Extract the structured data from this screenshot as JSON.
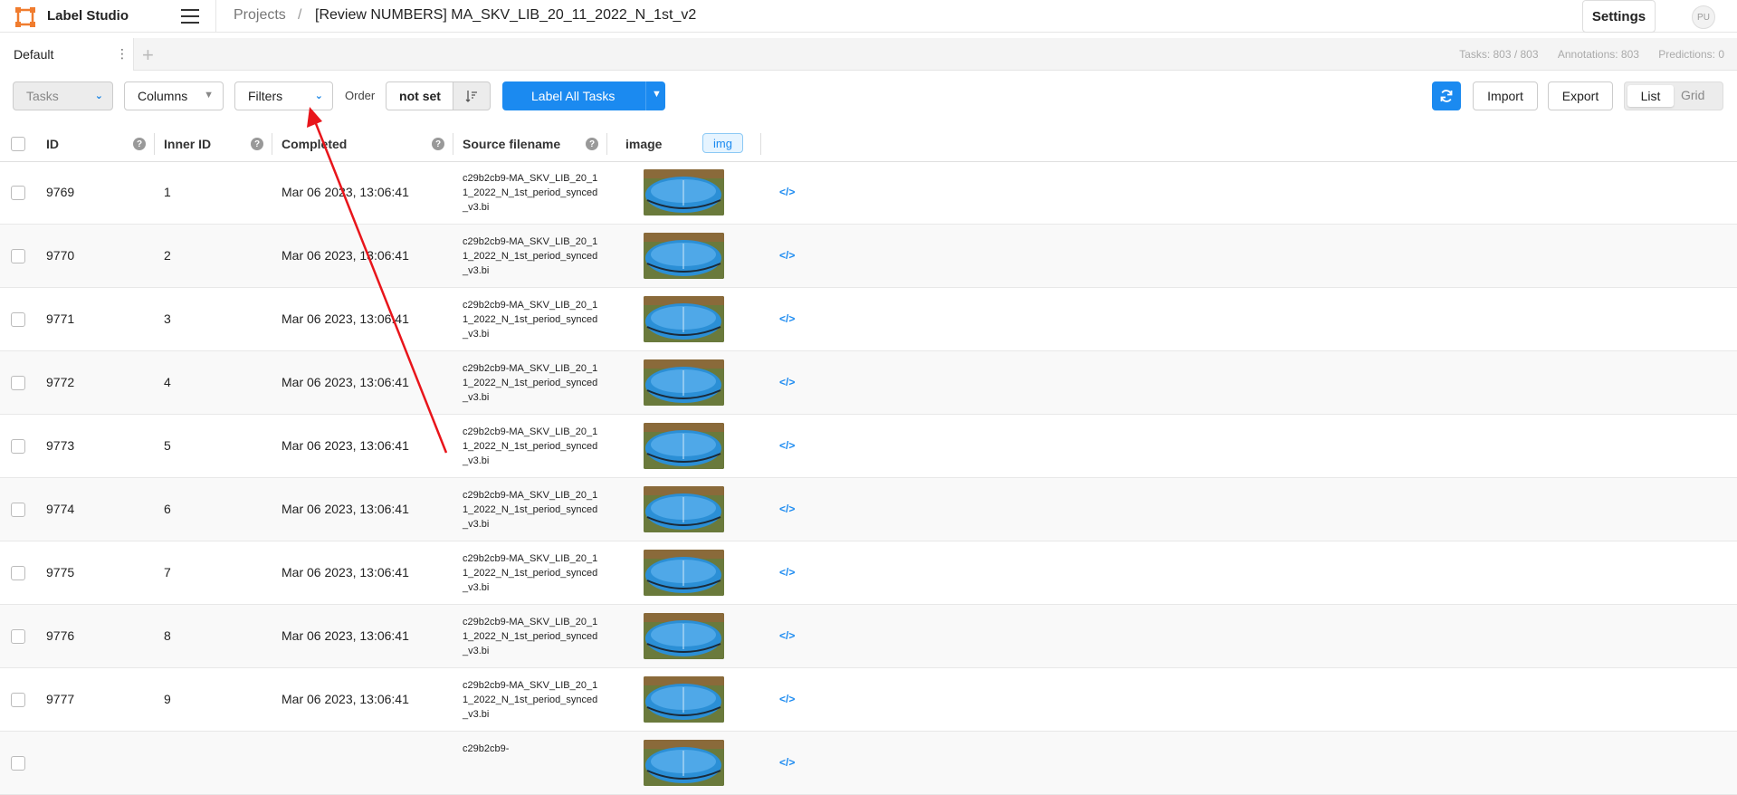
{
  "app": {
    "name": "Label Studio",
    "user_initials": "PU"
  },
  "breadcrumb": {
    "projects": "Projects",
    "separator": "/",
    "title": "[Review NUMBERS] MA_SKV_LIB_20_11_2022_N_1st_v2"
  },
  "header": {
    "settings_label": "Settings"
  },
  "tabs": {
    "items": [
      {
        "label": "Default"
      }
    ],
    "add": "+",
    "menu": "⋮"
  },
  "stats": {
    "tasks": "Tasks: 803 / 803",
    "annotations": "Annotations: 803",
    "predictions": "Predictions: 0"
  },
  "toolbar": {
    "tasks_label": "Tasks",
    "columns_label": "Columns",
    "filters_label": "Filters",
    "order_label": "Order",
    "order_value": "not set",
    "label_all_label": "Label All Tasks",
    "import_label": "Import",
    "export_label": "Export",
    "view_list": "List",
    "view_grid": "Grid"
  },
  "table": {
    "columns": [
      "ID",
      "Inner ID",
      "Completed",
      "Source filename",
      "image",
      "img"
    ],
    "help_glyph": "?",
    "rows": [
      {
        "id": "9769",
        "inner_id": "1",
        "completed": "Mar 06 2023, 13:06:41",
        "source": "c29b2cb9-MA_SKV_LIB_20_11_2022_N_1st_period_synced_v3.bi"
      },
      {
        "id": "9770",
        "inner_id": "2",
        "completed": "Mar 06 2023, 13:06:41",
        "source": "c29b2cb9-MA_SKV_LIB_20_11_2022_N_1st_period_synced_v3.bi"
      },
      {
        "id": "9771",
        "inner_id": "3",
        "completed": "Mar 06 2023, 13:06:41",
        "source": "c29b2cb9-MA_SKV_LIB_20_11_2022_N_1st_period_synced_v3.bi"
      },
      {
        "id": "9772",
        "inner_id": "4",
        "completed": "Mar 06 2023, 13:06:41",
        "source": "c29b2cb9-MA_SKV_LIB_20_11_2022_N_1st_period_synced_v3.bi"
      },
      {
        "id": "9773",
        "inner_id": "5",
        "completed": "Mar 06 2023, 13:06:41",
        "source": "c29b2cb9-MA_SKV_LIB_20_11_2022_N_1st_period_synced_v3.bi"
      },
      {
        "id": "9774",
        "inner_id": "6",
        "completed": "Mar 06 2023, 13:06:41",
        "source": "c29b2cb9-MA_SKV_LIB_20_11_2022_N_1st_period_synced_v3.bi"
      },
      {
        "id": "9775",
        "inner_id": "7",
        "completed": "Mar 06 2023, 13:06:41",
        "source": "c29b2cb9-MA_SKV_LIB_20_11_2022_N_1st_period_synced_v3.bi"
      },
      {
        "id": "9776",
        "inner_id": "8",
        "completed": "Mar 06 2023, 13:06:41",
        "source": "c29b2cb9-MA_SKV_LIB_20_11_2022_N_1st_period_synced_v3.bi"
      },
      {
        "id": "9777",
        "inner_id": "9",
        "completed": "Mar 06 2023, 13:06:41",
        "source": "c29b2cb9-MA_SKV_LIB_20_11_2022_N_1st_period_synced_v3.bi"
      },
      {
        "id": "",
        "inner_id": "",
        "completed": "",
        "source": "c29b2cb9-"
      }
    ],
    "code_glyph": "</>"
  },
  "colors": {
    "accent": "#1b8af0",
    "annotation_arrow": "#e8151b"
  },
  "icons": {
    "logo": "label-studio-logo-icon",
    "menu": "hamburger-icon",
    "refresh": "refresh-icon",
    "sort": "sort-icon"
  }
}
